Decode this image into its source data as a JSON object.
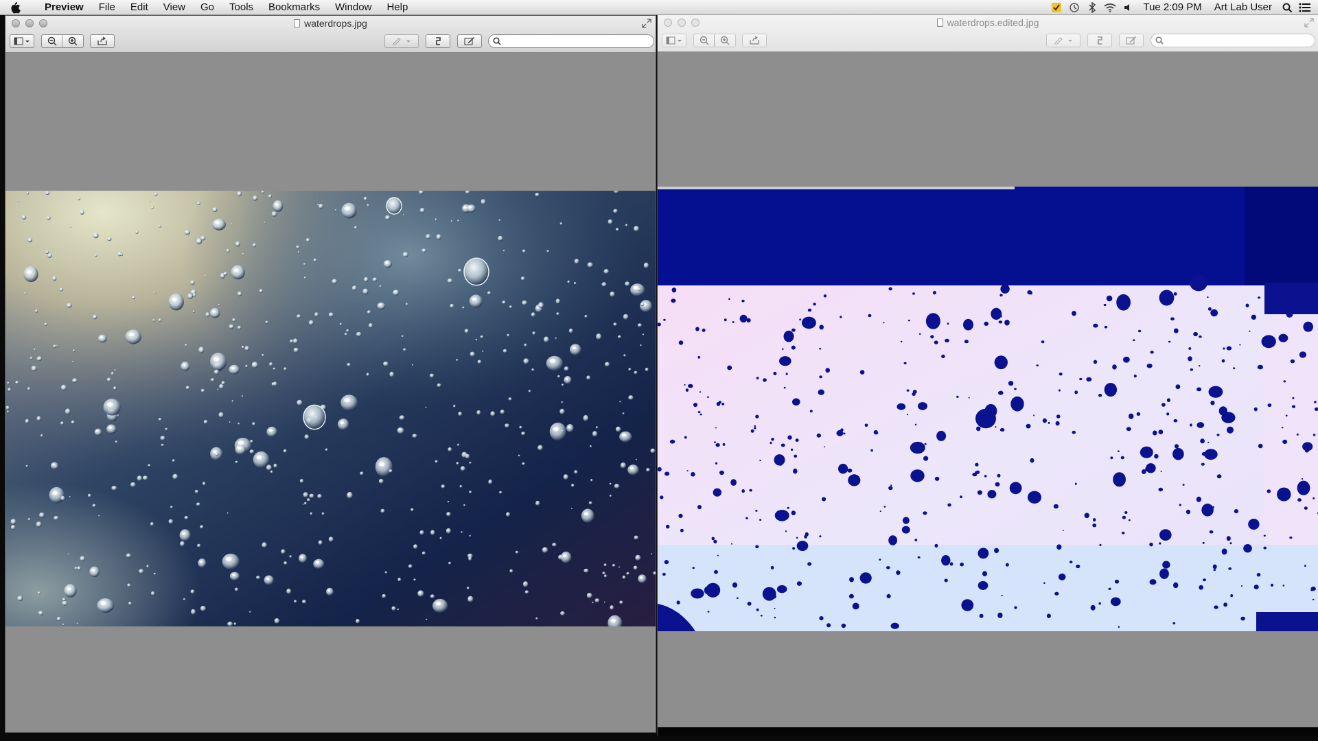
{
  "menubar": {
    "app_name": "Preview",
    "items": [
      "File",
      "Edit",
      "View",
      "Go",
      "Tools",
      "Bookmarks",
      "Window",
      "Help"
    ],
    "clock": "Tue 2:09 PM",
    "user": "Art Lab User"
  },
  "windows": {
    "left": {
      "title": "waterdrops.jpg"
    },
    "right": {
      "title": "waterdrops.edited.jpg"
    }
  },
  "colors": {
    "content_bg": "#8e8e8e",
    "left_photo_top": "#c9cdb3",
    "left_photo_dark": "#18234a",
    "right_band_blue": "#04108f",
    "right_light": "#ece6fb",
    "right_lower": "#d6e4fb",
    "drop_blue": "#0a1290"
  },
  "icons": {
    "menubar_left": [
      "apple-icon"
    ],
    "menubar_right": [
      "checkmark-status-icon",
      "time-machine-icon",
      "bluetooth-icon",
      "wifi-icon",
      "volume-icon",
      "spotlight-icon",
      "notification-center-icon"
    ],
    "toolbar": [
      "sidebar-view-icon",
      "zoom-out-icon",
      "zoom-in-icon",
      "share-icon",
      "markup-pen-icon",
      "rotate-icon",
      "edit-toolbar-icon",
      "search-icon"
    ]
  }
}
